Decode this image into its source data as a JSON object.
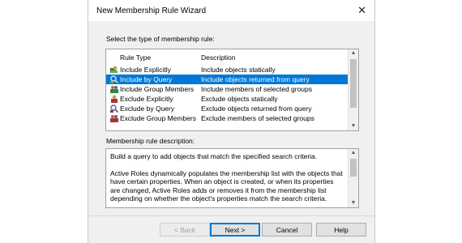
{
  "window": {
    "title": "New Membership Rule Wizard",
    "close_glyph": "✕"
  },
  "section1": {
    "label": "Select the type of membership rule:"
  },
  "list": {
    "columns": [
      "Rule Type",
      "Description"
    ],
    "rows": [
      {
        "name": "Include Explicitly",
        "desc": "Include objects statically",
        "icon": "include-explicit-icon"
      },
      {
        "name": "Include by Query",
        "desc": "Include objects returned from query",
        "icon": "include-query-icon",
        "selected": true
      },
      {
        "name": "Include Group Members",
        "desc": "Include members of selected groups",
        "icon": "include-group-icon"
      },
      {
        "name": "Exclude Explicitly",
        "desc": "Exclude objects statically",
        "icon": "exclude-explicit-icon"
      },
      {
        "name": "Exclude by Query",
        "desc": "Exclude objects returned from query",
        "icon": "exclude-query-icon"
      },
      {
        "name": "Exclude Group Members",
        "desc": "Exclude members of selected groups",
        "icon": "exclude-group-icon"
      }
    ]
  },
  "section2": {
    "label": "Membership rule description:",
    "paragraph1": "Build a query to add objects that match the specified search criteria.",
    "paragraph2": "Active Roles dynamically populates the membership list with the objects that have certain properties. When an object is created, or when its properties are changed, Active Roles adds or removes it from the membership list depending on whether the object's properties match the search criteria."
  },
  "buttons": {
    "back": "< Back",
    "next": "Next >",
    "cancel": "Cancel",
    "help": "Help"
  },
  "colors": {
    "selection": "#0078d7",
    "dialog_bg": "#f0f0f0"
  }
}
